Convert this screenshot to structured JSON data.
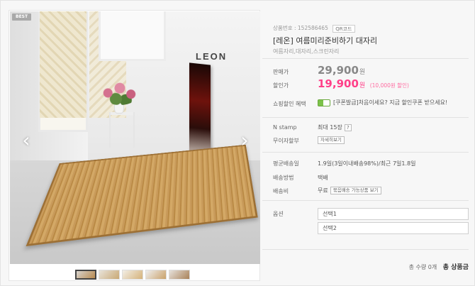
{
  "gallery": {
    "badge": "BEST",
    "brand_mark": "LEON",
    "prev_icon": "‹",
    "next_icon": "›",
    "thumbnails": 5
  },
  "product": {
    "code_label": "상품번호 : 152586465",
    "qr_label": "QR코드",
    "title": "[레온] 여름미리준비하기 대자리",
    "subtitle": "여름자리,대자리,스크린자리"
  },
  "price": {
    "sale_label": "판매가",
    "original": "29,900",
    "unit": "원",
    "discount_label": "할인가",
    "discounted": "19,900",
    "discount_note": "(10,000원 할인)"
  },
  "coupon": {
    "label": "쇼핑할인 혜택",
    "text": "[쿠폰발급]처음이세요? 지금 할인쿠폰 받으세요!"
  },
  "stamp": {
    "label": "N stamp",
    "value": "최대 15장",
    "help": "?"
  },
  "installment": {
    "label": "무이자할부",
    "button": "자세히보기"
  },
  "delivery": {
    "avg_label": "평균배송일",
    "avg_value": "1.9일(3일이내배송98%)/최근 7일1.8일",
    "method_label": "배송방법",
    "method_value": "택배",
    "fee_label": "배송비",
    "fee_value": "무료",
    "fee_button": "묶음배송 가능상품 보기"
  },
  "options": {
    "label": "옵션",
    "select1": "선택1",
    "select2": "선택2"
  },
  "total": {
    "qty_text": "총 수량 0개",
    "amount_label": "총 상품금"
  },
  "colors": {
    "accent": "#ff3f88",
    "green": "#7cc24a"
  }
}
